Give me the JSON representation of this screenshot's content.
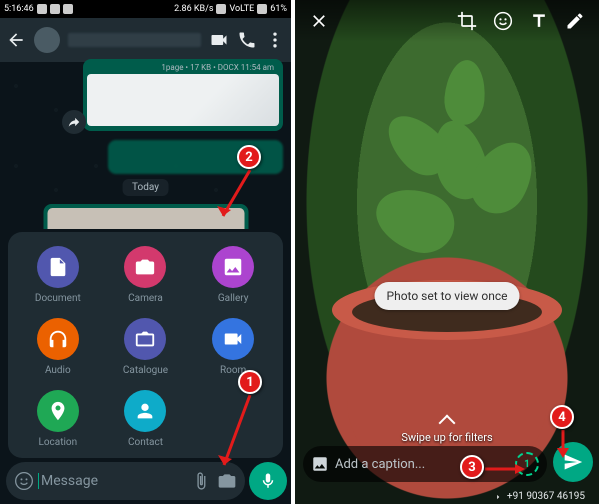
{
  "status_bar": {
    "time": "5:16:46",
    "battery": "61%",
    "net1": "2.86 KB/s",
    "band": "VoLTE"
  },
  "chat": {
    "date_label": "Today",
    "doc_meta": "1page • 17 KB • DOCX    11:54 am",
    "input_placeholder": "Message"
  },
  "attachments": [
    {
      "key": "document",
      "label": "Document",
      "color": "#5157ae"
    },
    {
      "key": "camera",
      "label": "Camera",
      "color": "#d3396d"
    },
    {
      "key": "gallery",
      "label": "Gallery",
      "color": "#ac44cf"
    },
    {
      "key": "audio",
      "label": "Audio",
      "color": "#eb6100"
    },
    {
      "key": "catalogue",
      "label": "Catalogue",
      "color": "#5157ae"
    },
    {
      "key": "room",
      "label": "Room",
      "color": "#3474e0"
    },
    {
      "key": "location",
      "label": "Location",
      "color": "#1fa855"
    },
    {
      "key": "contact",
      "label": "Contact",
      "color": "#0eabc9"
    }
  ],
  "preview": {
    "toast": "Photo set to view once",
    "swipe_hint": "Swipe up for filters",
    "caption_placeholder": "Add a caption...",
    "view_once_symbol": "1",
    "recipient": "+91 90367 46195"
  },
  "callouts": {
    "c1": "1",
    "c2": "2",
    "c3": "3",
    "c4": "4"
  }
}
